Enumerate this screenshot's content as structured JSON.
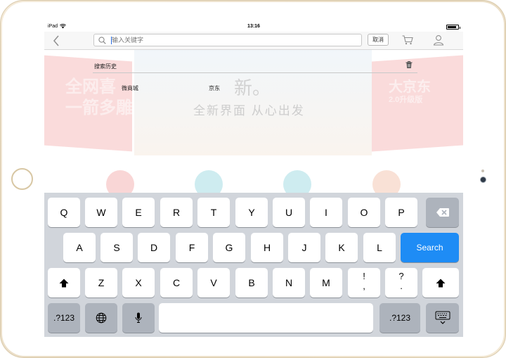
{
  "device": {
    "name": "iPad"
  },
  "status_bar": {
    "carrier": "iPad",
    "time": "13:16",
    "battery_level": 0.85
  },
  "nav": {
    "search_placeholder": "输入关键字",
    "cancel_label": "取消",
    "icons": [
      "back-arrow-icon",
      "search-icon",
      "cart-icon",
      "user-icon"
    ]
  },
  "banner": {
    "left_text_line1": "全网喜",
    "left_text_line2": "一箭多雕",
    "brand": "新。",
    "slogan": "全新界面  从心出发",
    "right_title": "大京东",
    "right_sub": "2.0升级版"
  },
  "history": {
    "title": "搜索历史",
    "items": [
      "微商城",
      "京东"
    ]
  },
  "keyboard": {
    "row1": [
      "Q",
      "W",
      "E",
      "R",
      "T",
      "Y",
      "U",
      "I",
      "O",
      "P"
    ],
    "row2": [
      "A",
      "S",
      "D",
      "F",
      "G",
      "H",
      "J",
      "K",
      "L"
    ],
    "row3": [
      "Z",
      "X",
      "C",
      "V",
      "B",
      "N",
      "M"
    ],
    "punct1": [
      "!",
      ","
    ],
    "punct2": [
      "?",
      "."
    ],
    "search_label": "Search",
    "numbers_label": ".?123"
  },
  "colors": {
    "search_key": "#1e8cf5",
    "keyboard_bg": "#d1d5db",
    "frame_gold": "#e9dcc4"
  }
}
